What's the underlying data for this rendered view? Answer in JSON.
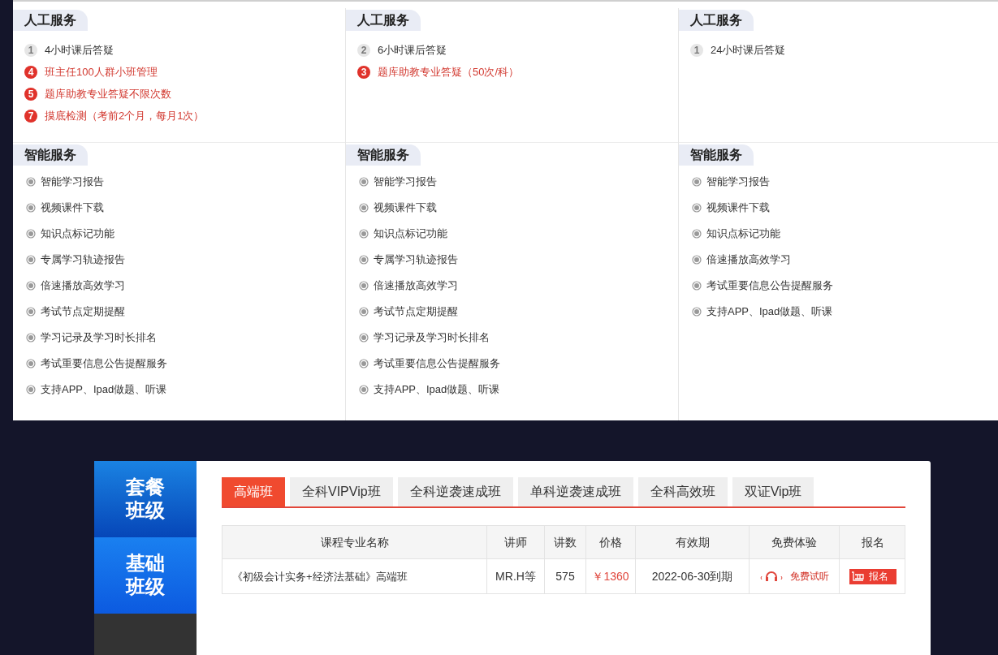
{
  "service_columns": [
    {
      "manual_title": "人工服务",
      "manual_items": [
        {
          "number": "1",
          "text": "4小时课后答疑",
          "highlight": false
        },
        {
          "number": "4",
          "text": "班主任100人群小班管理",
          "highlight": true
        },
        {
          "number": "5",
          "text": "题库助教专业答疑不限次数",
          "highlight": true
        },
        {
          "number": "7",
          "text": "摸底检测（考前2个月，每月1次）",
          "highlight": true
        }
      ],
      "smart_title": "智能服务",
      "smart_items": [
        "智能学习报告",
        "视频课件下载",
        "知识点标记功能",
        "专属学习轨迹报告",
        "倍速播放高效学习",
        "考试节点定期提醒",
        "学习记录及学习时长排名",
        "考试重要信息公告提醒服务",
        "支持APP、Ipad做题、听课"
      ]
    },
    {
      "manual_title": "人工服务",
      "manual_items": [
        {
          "number": "2",
          "text": "6小时课后答疑",
          "highlight": false
        },
        {
          "number": "3",
          "text": "题库助教专业答疑（50次/科）",
          "highlight": true
        }
      ],
      "smart_title": "智能服务",
      "smart_items": [
        "智能学习报告",
        "视频课件下载",
        "知识点标记功能",
        "专属学习轨迹报告",
        "倍速播放高效学习",
        "考试节点定期提醒",
        "学习记录及学习时长排名",
        "考试重要信息公告提醒服务",
        "支持APP、Ipad做题、听课"
      ]
    },
    {
      "manual_title": "人工服务",
      "manual_items": [
        {
          "number": "1",
          "text": "24小时课后答疑",
          "highlight": false
        }
      ],
      "smart_title": "智能服务",
      "smart_items": [
        "智能学习报告",
        "视频课件下载",
        "知识点标记功能",
        "倍速播放高效学习",
        "考试重要信息公告提醒服务",
        "支持APP、Ipad做题、听课"
      ]
    }
  ],
  "sidebar": {
    "items": [
      {
        "label": "套餐班级",
        "selected": true
      },
      {
        "label": "基础班级",
        "selected": false
      }
    ]
  },
  "tabs": [
    {
      "label": "高端班",
      "selected": true
    },
    {
      "label": "全科VIPVip班",
      "selected": false
    },
    {
      "label": "全科逆袭速成班",
      "selected": false
    },
    {
      "label": "单科逆袭速成班",
      "selected": false
    },
    {
      "label": "全科高效班",
      "selected": false
    },
    {
      "label": "双证Vip班",
      "selected": false
    }
  ],
  "table": {
    "columns": [
      "课程专业名称",
      "讲师",
      "讲数",
      "价格",
      "有效期",
      "免费体验",
      "报名"
    ],
    "rows": [
      {
        "name": "《初级会计实务+经济法基础》高端班",
        "teacher": "MR.H等",
        "lessons": "575",
        "price": "￥1360",
        "validity": "2022-06-30到期",
        "trial": "免费试听",
        "signup": "报名"
      }
    ]
  }
}
